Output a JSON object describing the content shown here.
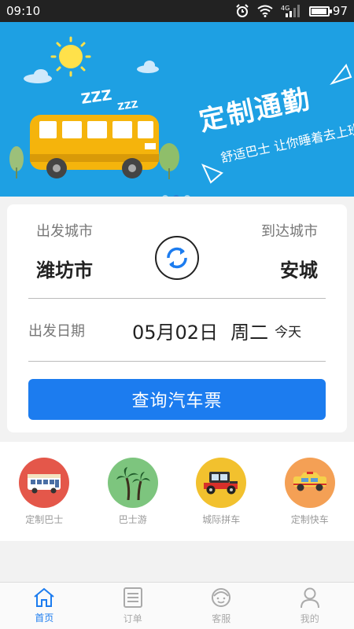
{
  "status_bar": {
    "time": "09:10",
    "network": "4G",
    "battery": 97
  },
  "banner": {
    "title": "定制通勤",
    "subtitle": "舒适巴士 让你睡着去上班",
    "snore": [
      "ZZZ",
      "ZZZ"
    ],
    "slides": 3,
    "active_slide": 1
  },
  "trip": {
    "from_label": "出发城市",
    "to_label": "到达城市",
    "from_city": "潍坊市",
    "to_city": "安城",
    "date_label": "出发日期",
    "date": "05月02日",
    "weekday": "周二",
    "today": "今天",
    "search_label": "查询汽车票"
  },
  "services": [
    {
      "label": "定制巴士",
      "icon": "bus-icon",
      "color": "#e4574a"
    },
    {
      "label": "巴士游",
      "icon": "palm-tree-icon",
      "color": "#7dc57e"
    },
    {
      "label": "城际拼车",
      "icon": "vintage-car-icon",
      "color": "#f2c12e"
    },
    {
      "label": "定制快车",
      "icon": "taxi-icon",
      "color": "#f4a055"
    }
  ],
  "bottom_nav": [
    {
      "label": "首页",
      "icon": "home-icon",
      "active": true
    },
    {
      "label": "订单",
      "icon": "order-list-icon",
      "active": false
    },
    {
      "label": "客服",
      "icon": "customer-service-icon",
      "active": false
    },
    {
      "label": "我的",
      "icon": "profile-icon",
      "active": false
    }
  ],
  "colors": {
    "accent": "#1c7cef",
    "banner_bg": "#1ea0e3",
    "bus": "#f5b40c"
  }
}
